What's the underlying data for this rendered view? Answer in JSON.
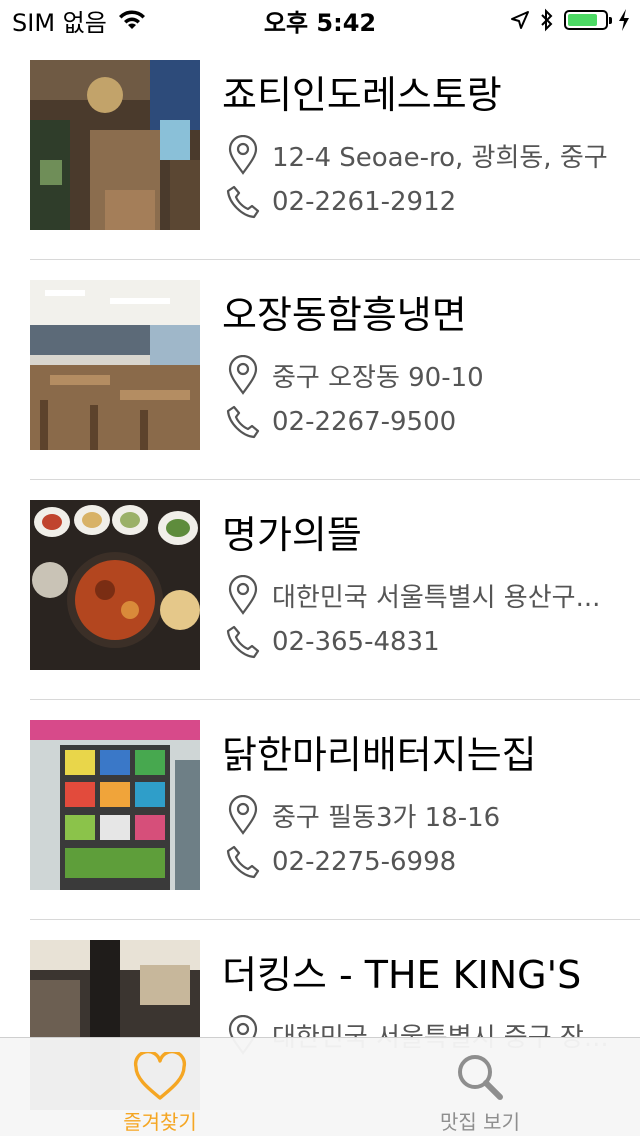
{
  "status_bar": {
    "carrier": "SIM 없음",
    "time": "오후 5:42",
    "battery_level": 0.8
  },
  "restaurants": [
    {
      "name": "죠티인도레스토랑",
      "address": "12-4 Seoae-ro, 광희동, 중구",
      "phone": "02-2261-2912",
      "photo": "restaurant-interior-photo"
    },
    {
      "name": "오장동함흥냉면",
      "address": "중구 오장동 90-10",
      "phone": "02-2267-9500",
      "photo": "dining-hall-photo"
    },
    {
      "name": "명가의뜰",
      "address": "대한민국 서울특별시 용산구...",
      "phone": "02-365-4831",
      "photo": "korean-food-table-photo"
    },
    {
      "name": "닭한마리배터지는집",
      "address": "중구 필동3가 18-16",
      "phone": "02-2275-6998",
      "photo": "snack-shelf-photo"
    },
    {
      "name": "더킹스 - THE KING'S",
      "address": "대한민국 서울특별시 중구 장...",
      "phone": "",
      "photo": "lounge-interior-photo"
    }
  ],
  "tab_bar": {
    "favorites_label": "즐겨찾기",
    "browse_label": "맛집 보기",
    "active_color": "#f5a623",
    "inactive_color": "#8e8e8e"
  }
}
